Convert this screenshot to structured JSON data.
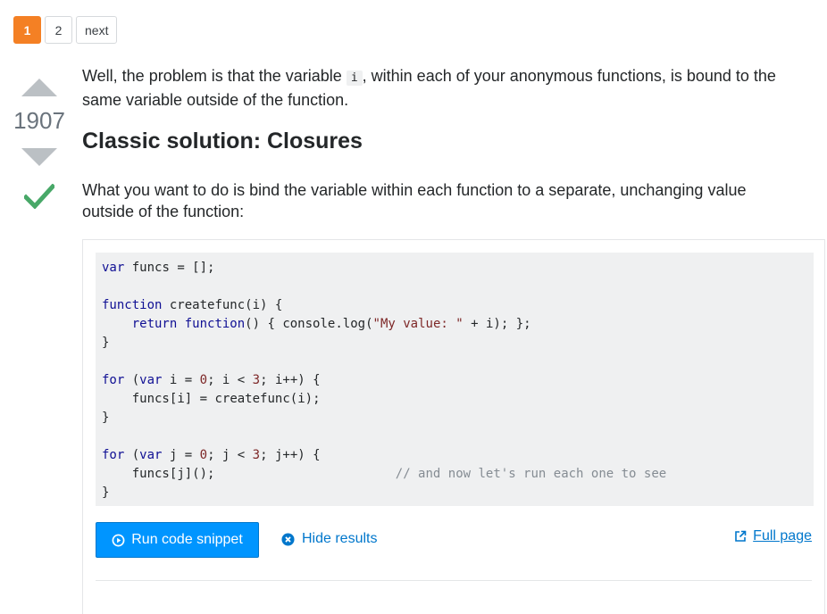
{
  "pagination": {
    "pages": [
      "1",
      "2"
    ],
    "current": "1",
    "next_label": "next"
  },
  "vote": {
    "count": "1907",
    "accepted": true
  },
  "post": {
    "p1_before": "Well, the problem is that the variable ",
    "p1_code": "i",
    "p1_after": ", within each of your anonymous functions, is bound to the same variable outside of the function.",
    "heading": "Classic solution: Closures",
    "p2": "What you want to do is bind the variable within each function to a separate, unchanging value outside of the function:"
  },
  "snippet": {
    "code_lines": [
      "var funcs = [];",
      "",
      "function createfunc(i) {",
      "    return function() { console.log(\"My value: \" + i); };",
      "}",
      "",
      "for (var i = 0; i < 3; i++) {",
      "    funcs[i] = createfunc(i);",
      "}",
      "",
      "for (var j = 0; j < 3; j++) {",
      "    funcs[j]();                        // and now let's run each one to see",
      "}"
    ],
    "run_label": "Run code snippet",
    "hide_label": "Hide results",
    "full_page_label": "Full page"
  },
  "colors": {
    "accent_orange": "#f48024",
    "run_blue": "#0095ff",
    "link_blue": "#0077cc",
    "accepted_green": "#48a868"
  }
}
